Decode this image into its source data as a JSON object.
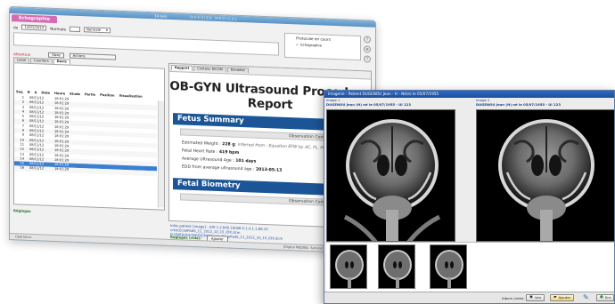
{
  "back_window": {
    "title": "14 avis",
    "header": "DOSSIER MEDICAL",
    "exam_tab": "Echographie",
    "toolbar": {
      "date_label": "du",
      "date_value": "12/01/2014",
      "context_label": "Normale",
      "select_value": "Normale",
      "alert_label": "Attention",
      "save_label": "Save",
      "actions_label": "Actions"
    },
    "tabs": [
      "Lasse",
      "Courriers",
      "Devis"
    ],
    "protocol": {
      "title": "Protocole en cours",
      "item": "Echographie"
    },
    "side_buttons": [
      "?",
      "⊕",
      "?"
    ],
    "list": {
      "headers": [
        "Seq",
        "N",
        "A",
        "Date",
        "Heure",
        "Etude",
        "Partie",
        "Position",
        "Visualisation"
      ],
      "rows": [
        {
          "n": "1",
          "date": "08/11/12",
          "time": "18:01:29"
        },
        {
          "n": "2",
          "date": "08/11/12",
          "time": "18:01:29"
        },
        {
          "n": "3",
          "date": "08/11/12",
          "time": "18:01:29"
        },
        {
          "n": "4",
          "date": "08/11/12",
          "time": "18:01:29"
        },
        {
          "n": "5",
          "date": "08/11/12",
          "time": "18:01:29"
        },
        {
          "n": "6",
          "date": "08/11/12",
          "time": "18:01:29"
        },
        {
          "n": "7",
          "date": "08/11/12",
          "time": "18:01:29"
        },
        {
          "n": "8",
          "date": "08/11/12",
          "time": "18:01:29"
        },
        {
          "n": "9",
          "date": "08/11/12",
          "time": "18:01:29"
        },
        {
          "n": "10",
          "date": "08/11/12",
          "time": "18:01:29"
        },
        {
          "n": "11",
          "date": "08/11/12",
          "time": "18:01:29"
        },
        {
          "n": "12",
          "date": "08/11/12",
          "time": "18:01:29"
        },
        {
          "n": "13",
          "date": "08/11/12",
          "time": "18:01:29"
        },
        {
          "n": "14",
          "date": "08/11/12",
          "time": "18:01:29"
        },
        {
          "n": "15",
          "date": "08/11/12",
          "time": "18:01:29"
        },
        {
          "n": "16",
          "date": "08/11/12",
          "time": "18:01:29"
        }
      ],
      "selected_index": 14
    },
    "list_footer": "Réglages",
    "status_left": "Opérateur",
    "status_right": "[Digital MEDIBA, Serveur Radio]"
  },
  "report": {
    "tabs": [
      "Rapport",
      "Contenu DICOM",
      "Bandelet"
    ],
    "title": "OB-GYN Ultrasound Procedure Report",
    "section1": "Fetus Summary",
    "obs1": "Observation Context : Fetus ID 1",
    "lines": [
      {
        "label": "Estimated Weight :",
        "value": "228 g",
        "note": "; inferred from : Equation EFW by AC, FL, HC, Ha"
      },
      {
        "label": "Fetal Heart Rate :",
        "value": "419 bpm",
        "note": ""
      },
      {
        "label": "Average Ultrasound Age :",
        "value": "101 days",
        "note": ""
      },
      {
        "label": "EDD from average ultrasound age :",
        "value": "2013-05-13",
        "note": ""
      }
    ],
    "section2": "Fetal Biometry",
    "obs2": "Observation Context : Fetus ID 1",
    "footer_lines": [
      "Infos patient [image]   - UID 1.2.840.10008.5.1.4.1.1.88.33",
      "crkecEcoeRsdS_11_2012_10_15_IDX.dcm",
      "D:\\DATA\\DICOM\\DICM\\IJE\\srkecEcoeRsdS_11_2012_10_15_IDX.dcm"
    ],
    "footer_green": "Réglages (vide):",
    "footer_button": "Ajouter"
  },
  "front_window": {
    "title": "Imagerie : Patient DUGENOU Jean - H - Né(e) le 05/07/1955",
    "image1_label": "Image 1",
    "image1_patient": "DUGENOU Jean (H) né le 05/07/1955 - UI 123",
    "image2_label": "Image 2",
    "image2_patient": "DUGENOU Jean (H) né le 05/07/1955 - UI 123",
    "bottom_caption": "Album (vide):",
    "btn_view": "Voir",
    "btn_add": "Ajouter",
    "btn_last": "Enr"
  }
}
